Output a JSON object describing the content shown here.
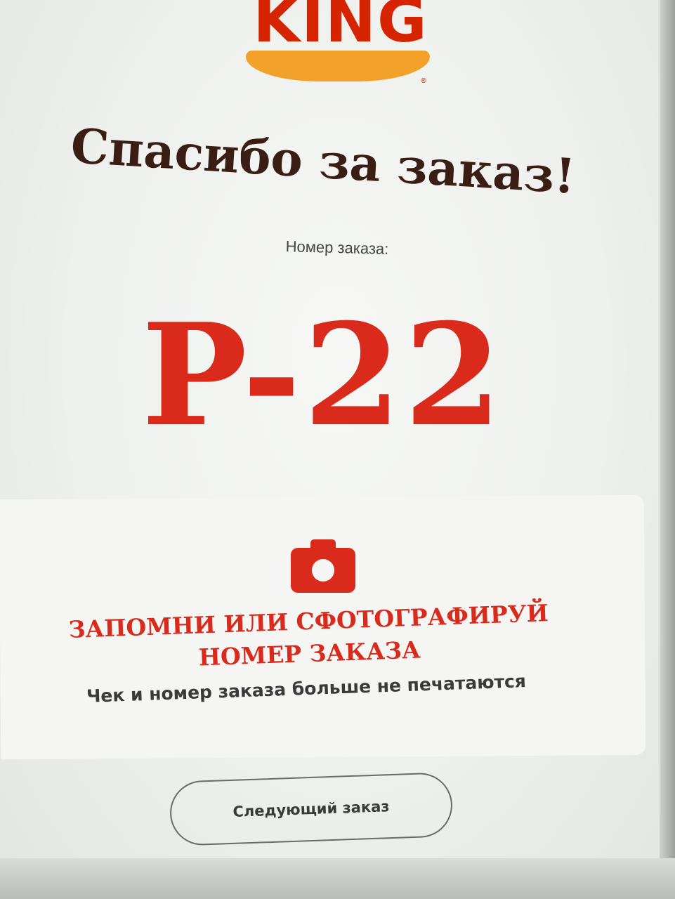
{
  "logo": {
    "brand_text": "KING"
  },
  "header": {
    "title": "Спасибо за заказ!"
  },
  "order": {
    "label": "Номер заказа:",
    "number": "P-22"
  },
  "notice": {
    "icon": "camera-icon",
    "heading_line1": "ЗАПОМНИ ИЛИ СФОТОГРАФИРУЙ",
    "heading_line2": "НОМЕР ЗАКАЗА",
    "note": "Чек и номер заказа больше не печатаются"
  },
  "actions": {
    "next_order_label": "Следующий заказ"
  },
  "colors": {
    "brand_red": "#d92a1c",
    "bun_orange": "#f2a12a",
    "title_brown": "#3a1d14"
  }
}
